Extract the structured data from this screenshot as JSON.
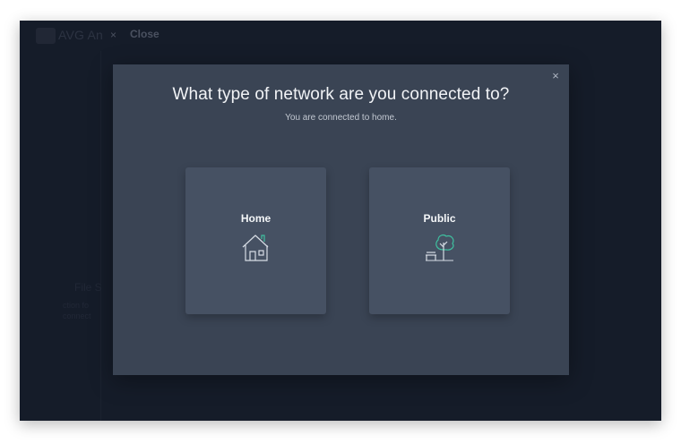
{
  "app": {
    "title": "AVG An",
    "close_label": "Close",
    "close_glyph": "×",
    "bg_heading": "File S",
    "bg_line1": "ction fo",
    "bg_line2": "connect"
  },
  "modal": {
    "title": "What type of network are you connected to?",
    "subtitle": "You are connected to home.",
    "close_glyph": "×"
  },
  "options": {
    "home": {
      "label": "Home",
      "icon": "house-icon"
    },
    "public": {
      "label": "Public",
      "icon": "park-tree-bench-icon"
    }
  },
  "colors": {
    "accent": "#3fbf9f",
    "modal_bg": "#3a4454",
    "card_bg": "#465163"
  }
}
